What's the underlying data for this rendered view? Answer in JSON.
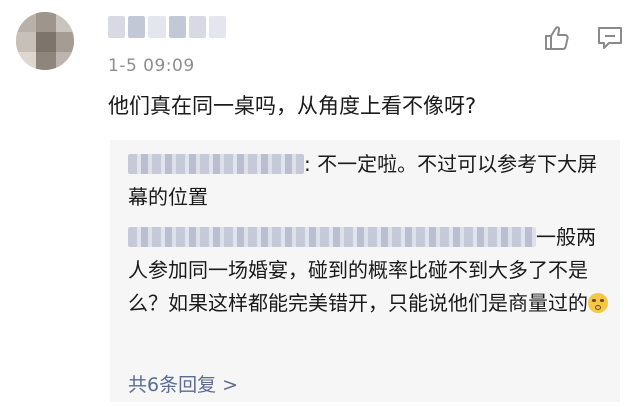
{
  "comment": {
    "time": "1-5 09:09",
    "text": "他们真在同一桌吗，从角度上看不像呀?",
    "icons": {
      "like": "thumbs-up-icon",
      "reply": "comment-bubble-icon"
    }
  },
  "replies": [
    {
      "text": ": 不一定啦。不过可以参考下大屏幕的位置"
    },
    {
      "text": "一般两人参加同一场婚宴，碰到的概率比碰不到大多了不是么？如果这样都能完美错开，只能说他们是商量过的"
    }
  ],
  "more_replies": "共6条回复 >",
  "colors": {
    "link": "#5b6b92",
    "reply_bg": "#f6f6f6",
    "time": "#8d8d8d"
  }
}
